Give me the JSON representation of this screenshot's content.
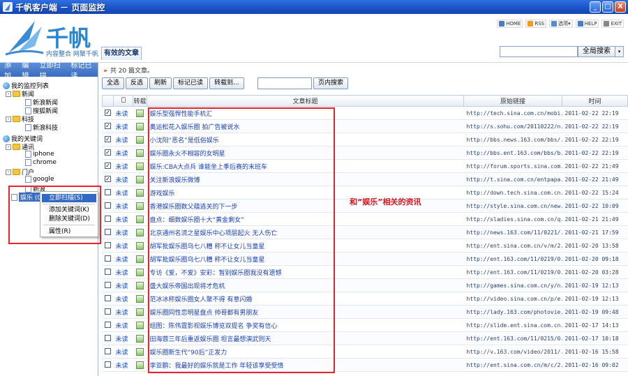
{
  "window": {
    "title": "千帆客户端 － 页面监控",
    "buttons": [
      "_",
      "□",
      "X"
    ]
  },
  "brand": {
    "name": "千帆",
    "slogan": "内容整合  网聚千帆"
  },
  "toplinks": [
    {
      "label": "HOME",
      "color": "#4a7dc8"
    },
    {
      "label": "RSS",
      "color": "#f29b1c"
    },
    {
      "label": "选项▾",
      "color": "#5a8ad0"
    },
    {
      "label": "HELP",
      "color": "#4a7dc8"
    },
    {
      "label": "EXIT",
      "color": "#888888"
    }
  ],
  "global_search": {
    "value": "",
    "button": "全局搜索",
    "dropdown": "▾"
  },
  "tab": "有效的文章",
  "left": {
    "toolbar": [
      "添加",
      "编辑",
      "立即扫描",
      "标记已读"
    ],
    "tree": {
      "monitor_root": "我的监控列表",
      "news": "新闻",
      "news_sina": "新浪新闻",
      "news_sohu": "搜狐新闻",
      "tech": "科技",
      "tech_sina": "新浪科技",
      "kw_root": "我的关键词",
      "comm": "通讯",
      "iphone": "iphone",
      "chrome": "chrome",
      "portal": "门户",
      "google": "google",
      "sina": "新浪",
      "ent": "娱乐 (0) ",
      "pm_minus": "-"
    },
    "context_menu": [
      "立即扫描(S)",
      "添加关键词(K)",
      "删除关键词(D)",
      "属性(R)"
    ]
  },
  "main": {
    "info_arrow": "»",
    "info": "共 20 篇文章。",
    "buttons": [
      "全选",
      "反选",
      "刷新",
      "标记已读",
      "转载到..."
    ],
    "page_search": {
      "value": "",
      "button": "页内搜索"
    },
    "columns": {
      "repost": "转载",
      "title": "文章标题",
      "link": "原始链接",
      "time": "时间"
    },
    "annotation": "和“娱乐”相关的资讯",
    "rows": [
      {
        "checked": true,
        "status": "未读",
        "title": "娱乐型强悍性能手机汇",
        "link": "http://tech.sina.com.cn/mobi...",
        "time": "2011-02-22 22:19"
      },
      {
        "checked": true,
        "status": "未读",
        "title": "奥运松花入娱乐圈 拍广告被说水",
        "link": "http://s.sohu.com/20110222/n...",
        "time": "2011-02-22 22:19"
      },
      {
        "checked": true,
        "status": "未读",
        "title": "小沈阳“恶名”是低俗娱乐",
        "link": "http://bbs.news.163.com/bbs/...",
        "time": "2011-02-22 22:19"
      },
      {
        "checked": true,
        "status": "未读",
        "title": "娱乐圈永火不相容的女明星",
        "link": "http://bbs.ent.163.com/bbs/b...",
        "time": "2011-02-22 22:19"
      },
      {
        "checked": true,
        "status": "未读",
        "title": "娱乐:CBA大点兵 谁能坐上季后赛的末班车",
        "link": "http://forum.sports.sina.com...",
        "time": "2011-02-22 21:49"
      },
      {
        "checked": true,
        "status": "未读",
        "title": "关注新浪娱乐微博",
        "link": "http://t.sina.com.cn/entpapa...",
        "time": "2011-02-22 21:49"
      },
      {
        "checked": false,
        "status": "未读",
        "title": "游戏娱乐",
        "link": "http://down.tech.sina.com.cn...",
        "time": "2011-02-22 15:24"
      },
      {
        "checked": false,
        "status": "未读",
        "title": "香港娱乐圈数父蕴逃关的下一步",
        "link": "http://style.sina.com.cn/new...",
        "time": "2011-02-22 10:09"
      },
      {
        "checked": false,
        "status": "未读",
        "title": "盘点：细数娱乐圈十大“黄金剩女”",
        "link": "http://sladies.sina.com.cn/q...",
        "time": "2011-02-21 21:49"
      },
      {
        "checked": false,
        "status": "未读",
        "title": "北京通州名流之星娱乐中心项层起火 无人伤亡",
        "link": "http://news.163.com/11/0221/...",
        "time": "2011-02-21 17:59"
      },
      {
        "checked": false,
        "status": "未读",
        "title": "胡军批娱乐圈乌七八糟 称不让女儿当童星",
        "link": "http://ent.sina.com.cn/v/m/2...",
        "time": "2011-02-20 13:58"
      },
      {
        "checked": false,
        "status": "未读",
        "title": "胡军批娱乐圈乌七八糟 称不让女儿当童星",
        "link": "http://ent.163.com/11/0219/0...",
        "time": "2011-02-20 09:18"
      },
      {
        "checked": false,
        "status": "未读",
        "title": "专访《爱，不爱》安彩：暂别娱乐圈我没有遗憾",
        "link": "http://ent.163.com/11/0219/0...",
        "time": "2011-02-20 03:28"
      },
      {
        "checked": false,
        "status": "未读",
        "title": "盛大娱乐帝国出现将才危机",
        "link": "http://games.sina.com.cn/y/n...",
        "time": "2011-02-19 12:13"
      },
      {
        "checked": false,
        "status": "未读",
        "title": "范冰冰称娱乐圈女人聚不得 有意闪婚",
        "link": "http://video.sina.com.cn/p/e...",
        "time": "2011-02-19 12:13"
      },
      {
        "checked": false,
        "status": "未读",
        "title": "娱乐圈同性恋明星盘点 帅哥都有男朋友",
        "link": "http://lady.163.com/photovie...",
        "time": "2011-02-19 09:48"
      },
      {
        "checked": false,
        "status": "未读",
        "title": "组图：陈伟霆影视娱乐博览双提名 争奖有信心",
        "link": "http://slide.ent.sina.com.cn...",
        "time": "2011-02-17 14:13"
      },
      {
        "checked": false,
        "status": "未读",
        "title": "田海蓉三年后重返娱乐圈 坦言最想演武则天",
        "link": "http://ent.163.com/11/0215/0...",
        "time": "2011-02-17 10:18"
      },
      {
        "checked": false,
        "status": "未读",
        "title": "娱乐圈新生代“90后”正发力",
        "link": "http://v.163.com/video/2011/...",
        "time": "2011-02-16 15:58"
      },
      {
        "checked": false,
        "status": "未读",
        "title": "李亚鹏：我最好的娱乐就是工作 年轻该享受受情",
        "link": "http://ent.sina.com.cn/m/c/2...",
        "time": "2011-02-16 09:02"
      }
    ]
  }
}
